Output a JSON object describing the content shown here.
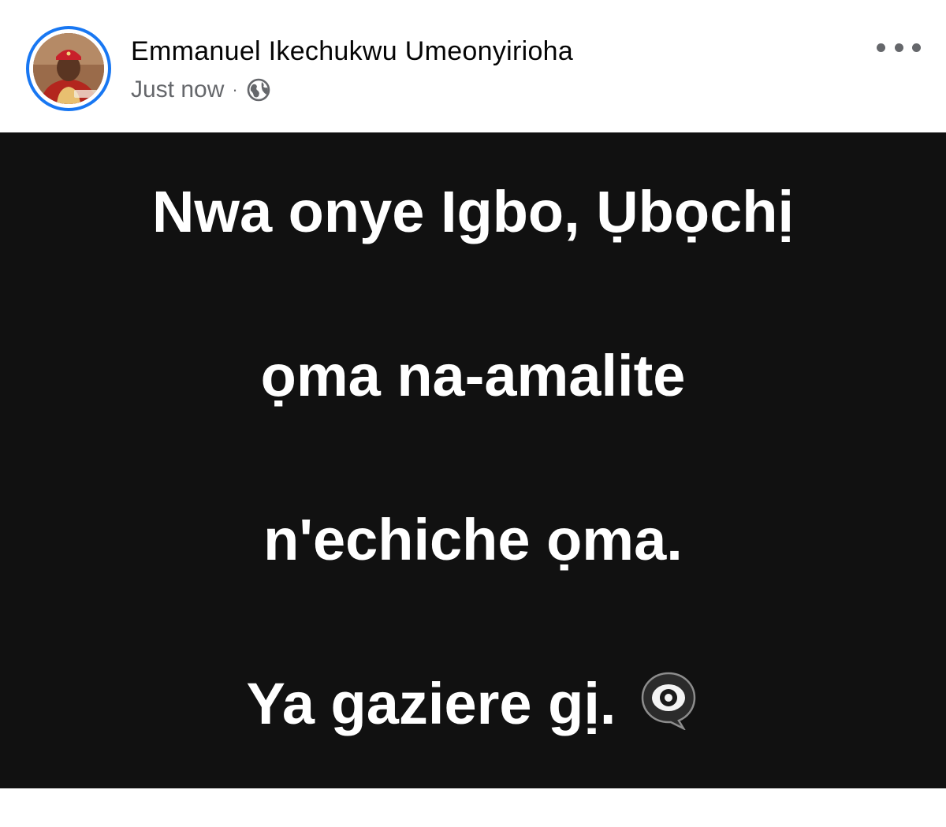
{
  "post": {
    "author": {
      "name": "Emmanuel Ikechukwu Umeonyirioha",
      "avatar_icon": "profile-photo"
    },
    "timestamp": "Just now",
    "separator": "·",
    "audience_icon": "globe-icon",
    "menu_icon": "more-horizontal-icon",
    "text_lines": [
      "Nwa onye Igbo, Ụbọchị",
      "ọma na-amalite",
      "n'echiche ọma.",
      "Ya gaziere gị."
    ],
    "emoji": "eye-in-speech-bubble",
    "background_color": "#111111",
    "text_color": "#ffffff",
    "accent_color": "#1877f2"
  }
}
